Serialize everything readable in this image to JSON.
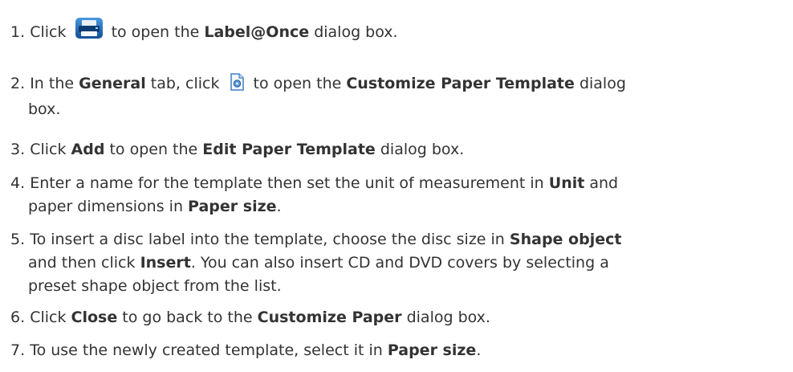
{
  "steps": [
    {
      "num": "1.",
      "t1": "Click",
      "t2": "to open the",
      "b1": "Label@Once",
      "t3": "dialog box."
    },
    {
      "num": "2.",
      "t1": "In the",
      "b1": "General",
      "t2": "tab, click",
      "t3": "to open the",
      "b2": "Customize Paper Template",
      "t4": "dialog",
      "t5": "box."
    },
    {
      "num": "3.",
      "t1": "Click",
      "b1": "Add",
      "t2": "to open the",
      "b2": "Edit Paper Template",
      "t3": "dialog box."
    },
    {
      "num": "4.",
      "t1": "Enter a name for the template then set the unit of measurement in",
      "b1": "Unit",
      "t2": "and",
      "t3": "paper dimensions in",
      "b2": "Paper size",
      "t4": "."
    },
    {
      "num": "5.",
      "t1": "To insert a disc label into the template, choose the disc size in",
      "b1": "Shape object",
      "t2": "and then click",
      "b2": "Insert",
      "t3": ". You can also insert CD and DVD covers by selecting a",
      "t4": "preset shape object from the list."
    },
    {
      "num": "6.",
      "t1": "Click",
      "b1": "Close",
      "t2": "to go back to the",
      "b2": "Customize Paper",
      "t3": "dialog box."
    },
    {
      "num": "7.",
      "t1": "To use the newly created template, select it in",
      "b1": "Paper size",
      "t2": "."
    }
  ],
  "icons": {
    "print": "printer-icon",
    "template": "paper-template-icon"
  },
  "colors": {
    "text": "#333333",
    "print_icon_blue": "#1b67b3",
    "template_icon_blue": "#3d7fc4"
  }
}
